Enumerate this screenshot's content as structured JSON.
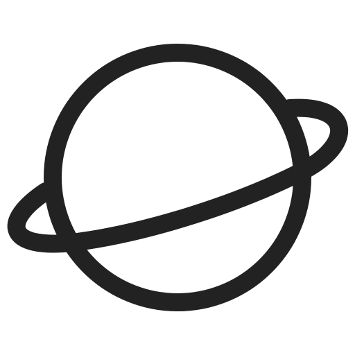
{
  "icon": {
    "name": "planet-icon",
    "stroke_color": "#222222",
    "background_color": "#ffffff"
  }
}
